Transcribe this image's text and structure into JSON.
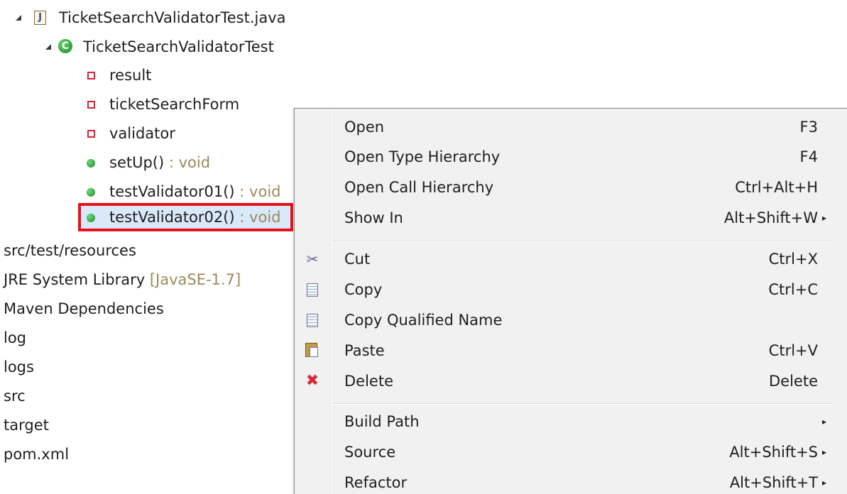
{
  "tree": {
    "file": {
      "name": "TicketSearchValidatorTest.java",
      "icon": "java-file-icon"
    },
    "class": {
      "name": "TicketSearchValidatorTest",
      "icon": "class-icon",
      "icon_glyph": "C"
    },
    "fields": [
      {
        "name": "result",
        "icon": "private-field-icon"
      },
      {
        "name": "ticketSearchForm",
        "icon": "private-field-icon"
      },
      {
        "name": "validator",
        "icon": "private-field-icon"
      }
    ],
    "methods": [
      {
        "name": "setUp()",
        "return_type": " : void",
        "icon": "public-method-icon"
      },
      {
        "name": "testValidator01()",
        "return_type": " : void",
        "icon": "public-method-icon"
      },
      {
        "name": "testValidator02()",
        "return_type": " : void",
        "icon": "public-method-icon",
        "selected": true
      }
    ],
    "folders": [
      {
        "name": "src/test/resources",
        "decoration": ""
      },
      {
        "name": "JRE System Library",
        "decoration": " [JavaSE-1.7]"
      },
      {
        "name": "Maven Dependencies",
        "decoration": ""
      },
      {
        "name": "log",
        "decoration": ""
      },
      {
        "name": "logs",
        "decoration": ""
      },
      {
        "name": "src",
        "decoration": ""
      },
      {
        "name": "target",
        "decoration": ""
      },
      {
        "name": "pom.xml",
        "decoration": ""
      }
    ],
    "highlight_color": "#e8111b"
  },
  "context_menu": {
    "items": [
      {
        "label": "Open",
        "shortcut": "F3"
      },
      {
        "label": "Open Type Hierarchy",
        "shortcut": "F4"
      },
      {
        "label": "Open Call Hierarchy",
        "shortcut": "Ctrl+Alt+H"
      },
      {
        "label": "Show In",
        "shortcut": "Alt+Shift+W",
        "submenu": true
      },
      {
        "label": "Cut",
        "shortcut": "Ctrl+X",
        "icon": "scissors-icon"
      },
      {
        "label": "Copy",
        "shortcut": "Ctrl+C",
        "icon": "copy-icon"
      },
      {
        "label": "Copy Qualified Name",
        "shortcut": "",
        "icon": "copy-qualified-name-icon"
      },
      {
        "label": "Paste",
        "shortcut": "Ctrl+V",
        "icon": "paste-icon"
      },
      {
        "label": "Delete",
        "shortcut": "Delete",
        "icon": "delete-x-icon"
      },
      {
        "label": "Build Path",
        "shortcut": "",
        "submenu": true
      },
      {
        "label": "Source",
        "shortcut": "Alt+Shift+S",
        "submenu": true
      },
      {
        "label": "Refactor",
        "shortcut": "Alt+Shift+T",
        "submenu": true
      }
    ],
    "submenu_arrow": "▸",
    "cut_glyph": "✂",
    "delete_glyph": "✖",
    "delete_color": "#d8283a"
  }
}
